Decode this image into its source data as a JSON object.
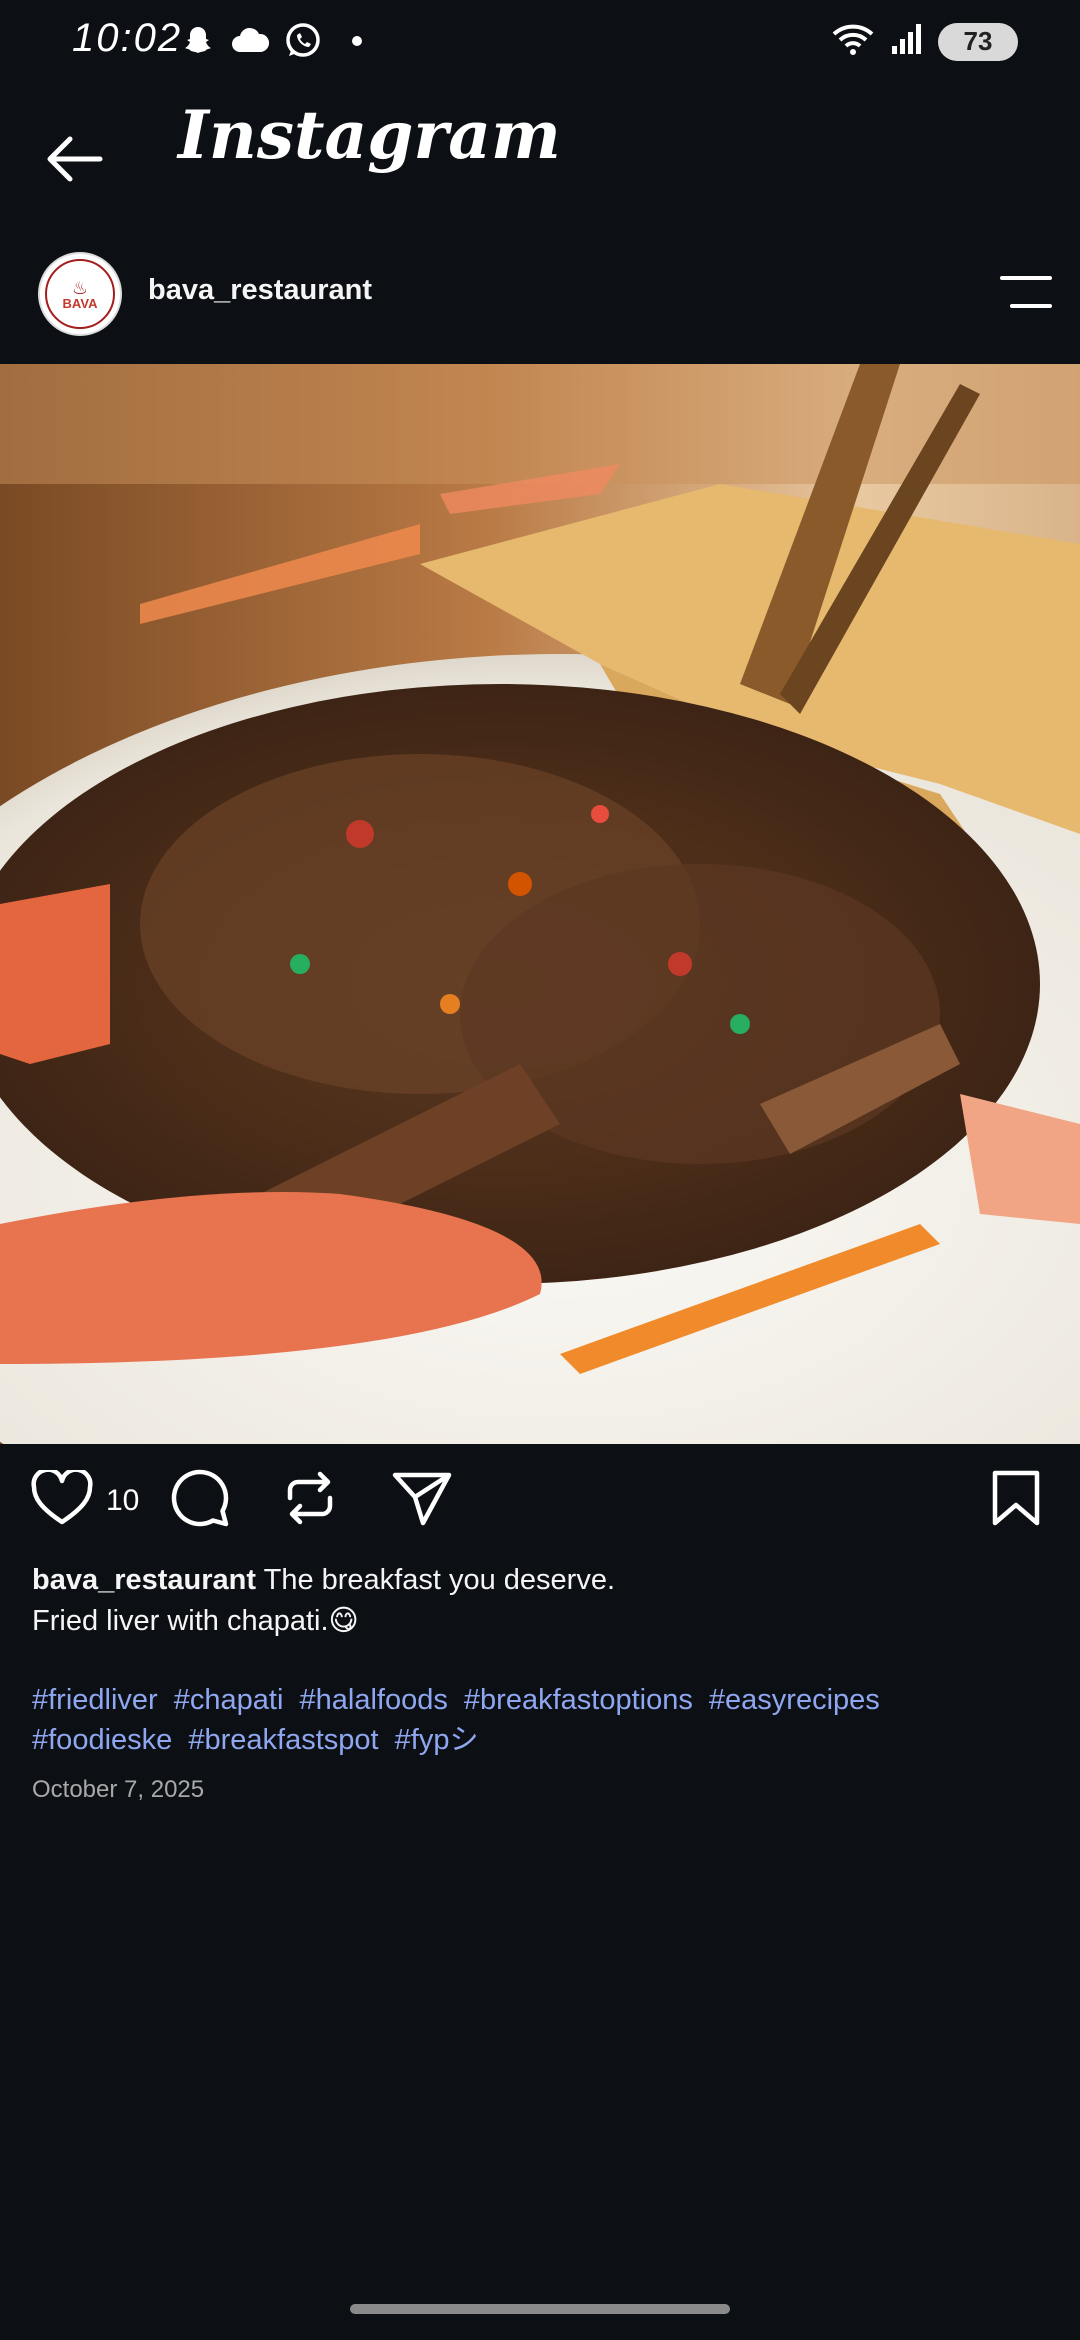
{
  "status_bar": {
    "time": "10:02",
    "battery": "73",
    "icons": [
      "snapchat-icon",
      "cloud-icon",
      "whatsapp-icon",
      "dot-icon",
      "wifi-icon",
      "signal-icon",
      "battery-icon"
    ]
  },
  "header": {
    "title": "Instagram",
    "back_icon": "arrow-left-icon"
  },
  "post": {
    "username": "bava_restaurant",
    "avatar_text": "BAVA",
    "menu_icon": "menu-icon",
    "image_description_icon": "food-photo",
    "likes": "10",
    "caption_user": "bava_restaurant",
    "caption_line1": "The breakfast you deserve.",
    "caption_line2": "Fried liver with chapati.😋",
    "hashtags": [
      "#friedliver",
      "#chapati",
      "#halalfoods",
      "#breakfastoptions",
      "#easyrecipes",
      "#foodieske",
      "#breakfastspot",
      "#fypシ"
    ],
    "date": "October 7, 2025"
  },
  "colors": {
    "background": "#0c1014",
    "hashtag": "#8fa6f0",
    "muted": "#a8a8a8"
  }
}
